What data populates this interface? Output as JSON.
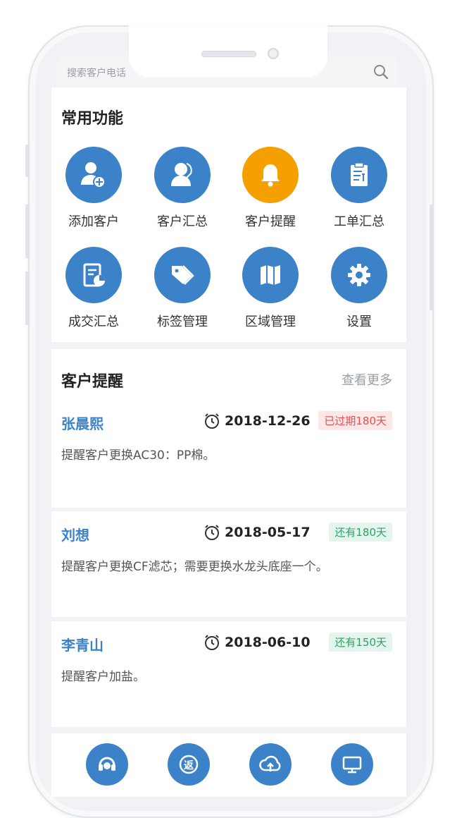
{
  "search": {
    "placeholder": "搜索客户电话"
  },
  "functions": {
    "title": "常用功能",
    "items": [
      {
        "label": "添加客户",
        "icon": "add-user-icon",
        "color": "#3c82c9"
      },
      {
        "label": "客户汇总",
        "icon": "customer-service-icon",
        "color": "#3c82c9"
      },
      {
        "label": "客户提醒",
        "icon": "bell-icon",
        "color": "#f5a000"
      },
      {
        "label": "工单汇总",
        "icon": "clipboard-icon",
        "color": "#3c82c9"
      },
      {
        "label": "成交汇总",
        "icon": "report-icon",
        "color": "#3c82c9"
      },
      {
        "label": "标签管理",
        "icon": "tag-icon",
        "color": "#3c82c9"
      },
      {
        "label": "区域管理",
        "icon": "map-icon",
        "color": "#3c82c9"
      },
      {
        "label": "设置",
        "icon": "gear-icon",
        "color": "#3c82c9"
      }
    ]
  },
  "reminders": {
    "title": "客户提醒",
    "more": "查看更多",
    "items": [
      {
        "name": "张晨熙",
        "date": "2018-12-26",
        "badge": "已过期180天",
        "desc": "提醒客户更换AC30：PP棉。"
      },
      {
        "name": "刘想",
        "date": "2018-05-17",
        "badge": "还有180天",
        "desc": "提醒客户更换CF滤芯；需要更换水龙头底座一个。"
      },
      {
        "name": "李青山",
        "date": "2018-06-10",
        "badge": "还有150天",
        "desc": "提醒客户加盐。"
      }
    ]
  },
  "bottom_nav": [
    {
      "icon": "headset-icon"
    },
    {
      "icon": "return-icon"
    },
    {
      "icon": "cloud-upload-icon"
    },
    {
      "icon": "monitor-icon"
    }
  ]
}
